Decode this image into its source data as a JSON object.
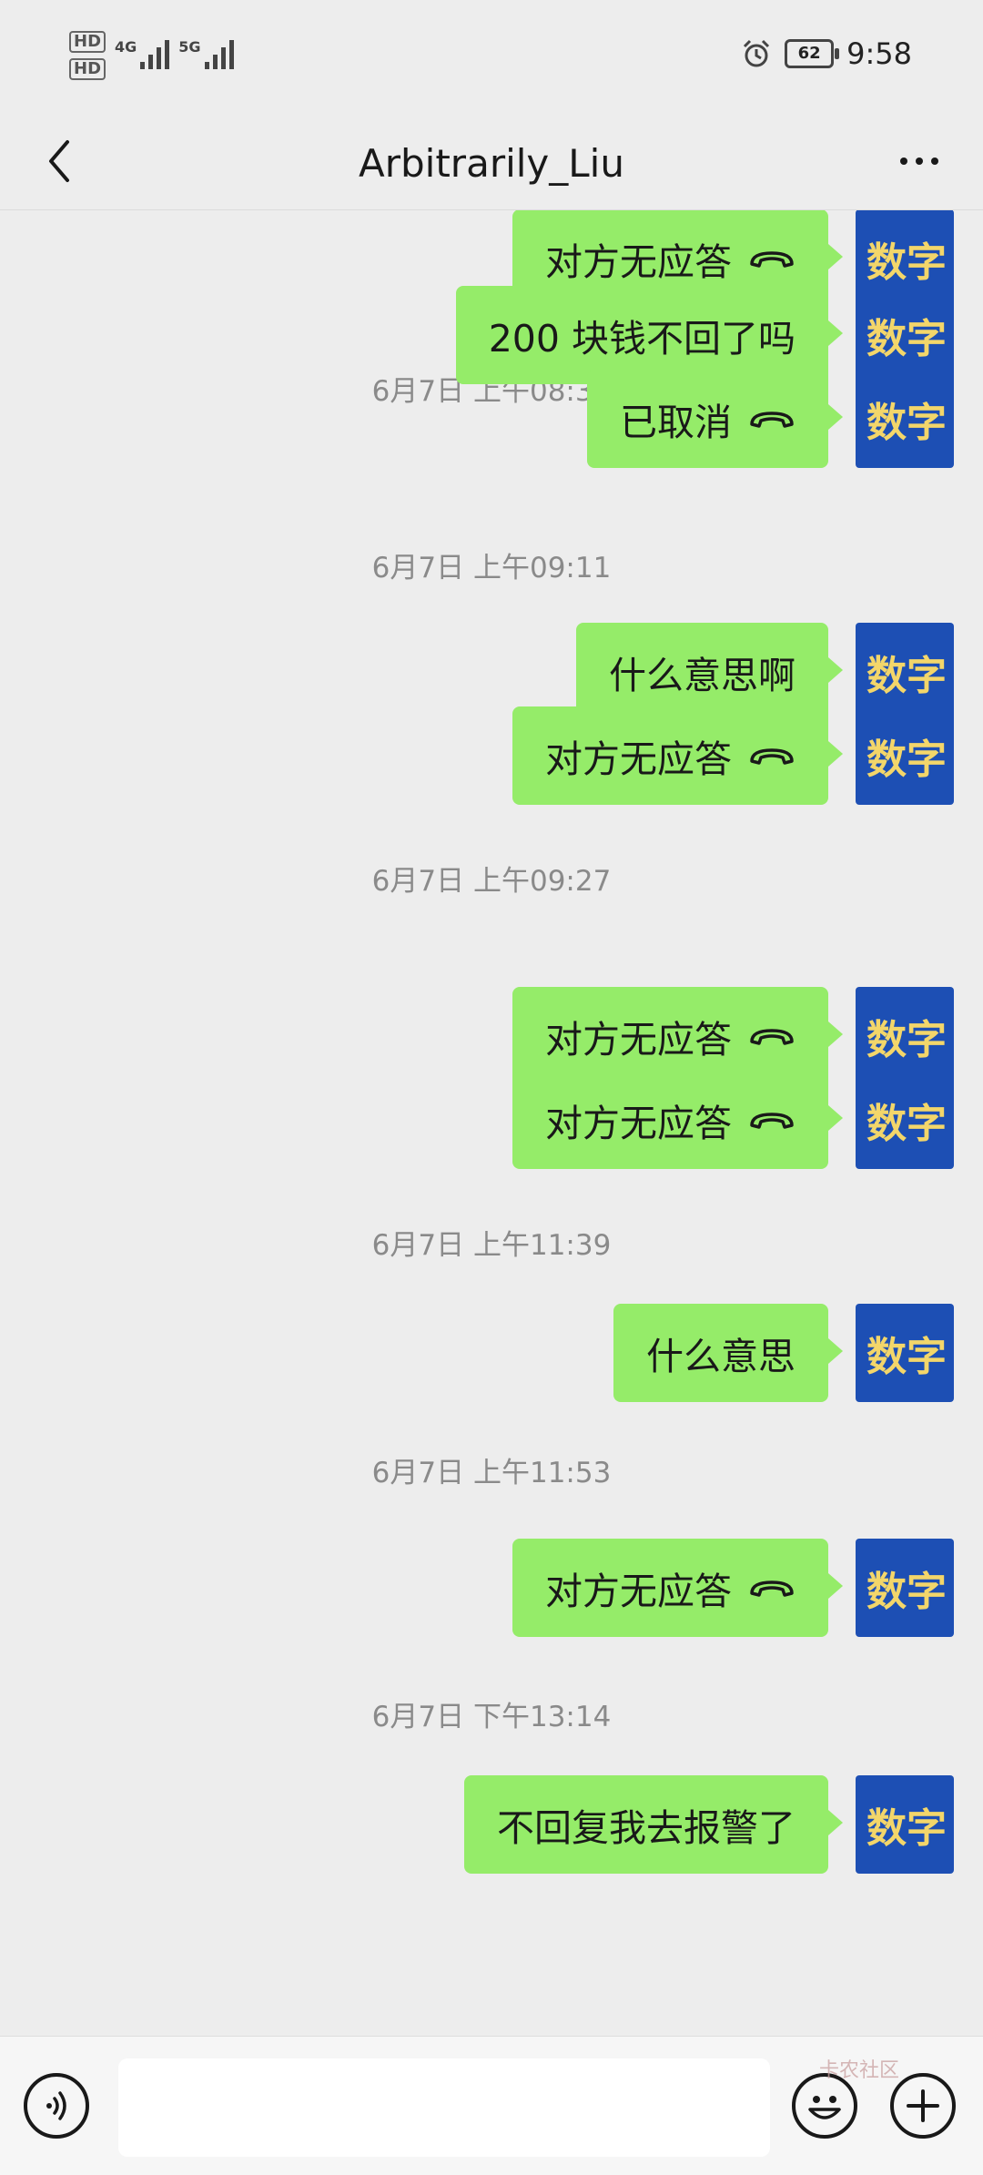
{
  "status_bar": {
    "sim1": "HD",
    "sim2": "HD",
    "net1": "4G",
    "net2": "5G",
    "battery": "62",
    "time": "9:58",
    "icons": [
      "alarm-icon",
      "battery-icon",
      "signal-icon"
    ]
  },
  "header": {
    "title": "Arbitrarily_Liu",
    "back_icon": "chevron-left-icon",
    "more_icon": "more-dots-icon"
  },
  "avatar_text": "数字",
  "messages": [
    {
      "type": "call",
      "text": "对方无应答"
    },
    {
      "type": "time",
      "text": "6月7日 上午08:32"
    },
    {
      "type": "text",
      "text": "200 块钱不回了吗"
    },
    {
      "type": "call",
      "text": "已取消"
    },
    {
      "type": "time",
      "text": "6月7日 上午09:11"
    },
    {
      "type": "text",
      "text": "什么意思啊"
    },
    {
      "type": "call",
      "text": "对方无应答"
    },
    {
      "type": "time",
      "text": "6月7日 上午09:27"
    },
    {
      "type": "call",
      "text": "对方无应答"
    },
    {
      "type": "call",
      "text": "对方无应答"
    },
    {
      "type": "time",
      "text": "6月7日 上午11:39"
    },
    {
      "type": "text",
      "text": "什么意思"
    },
    {
      "type": "time",
      "text": "6月7日 上午11:53"
    },
    {
      "type": "call",
      "text": "对方无应答"
    },
    {
      "type": "time",
      "text": "6月7日 下午13:14"
    },
    {
      "type": "text",
      "text": "不回复我去报警了"
    }
  ],
  "input_bar": {
    "placeholder": "",
    "icons": [
      "voice-icon",
      "emoji-icon",
      "plus-icon"
    ]
  },
  "watermark": "卡农社区",
  "colors": {
    "bubble": "#95ec69",
    "background": "#ededed",
    "avatar_bg": "#1d4fb4",
    "avatar_text": "#f3d66a"
  }
}
